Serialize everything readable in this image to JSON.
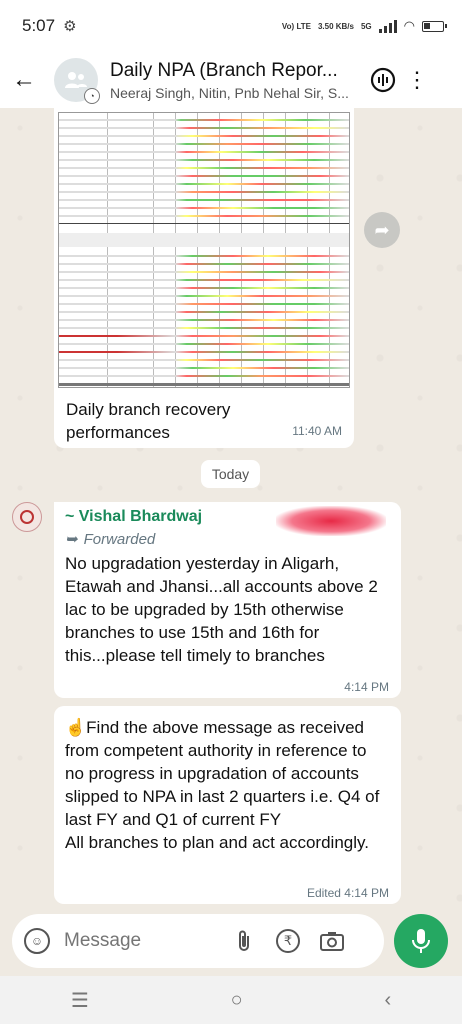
{
  "status": {
    "time": "5:07",
    "net1": "Vo) LTE",
    "speed": "3.50 KB/s",
    "net2": "5G"
  },
  "header": {
    "title": "Daily NPA (Branch Repor...",
    "subtitle": "Neeraj Singh, Nitin, Pnb Nehal Sir, S..."
  },
  "messages": {
    "image": {
      "caption": "Daily branch recovery performances",
      "time": "11:40 AM"
    },
    "date_chip": "Today",
    "m1": {
      "sender": "~ Vishal Bhardwaj",
      "forwarded": "Forwarded",
      "text": "No upgradation yesterday in Aligarh, Etawah and Jhansi...all accounts above 2 lac to be upgraded by 15th otherwise branches to use 15th and 16th for this...please tell timely to branches",
      "time": "4:14 PM"
    },
    "m2": {
      "emoji": "☝️",
      "text": "Find the above message as received from competent authority in reference to no progress in upgradation of accounts slipped to NPA in last 2 quarters i.e. Q4 of last FY and Q1 of current FY\nAll branches to plan and act accordingly.",
      "time": "Edited 4:14 PM"
    }
  },
  "input": {
    "placeholder": "Message"
  },
  "colors": {
    "accent": "#25a862",
    "sender": "#1a8a5a",
    "background": "#efeae2"
  }
}
